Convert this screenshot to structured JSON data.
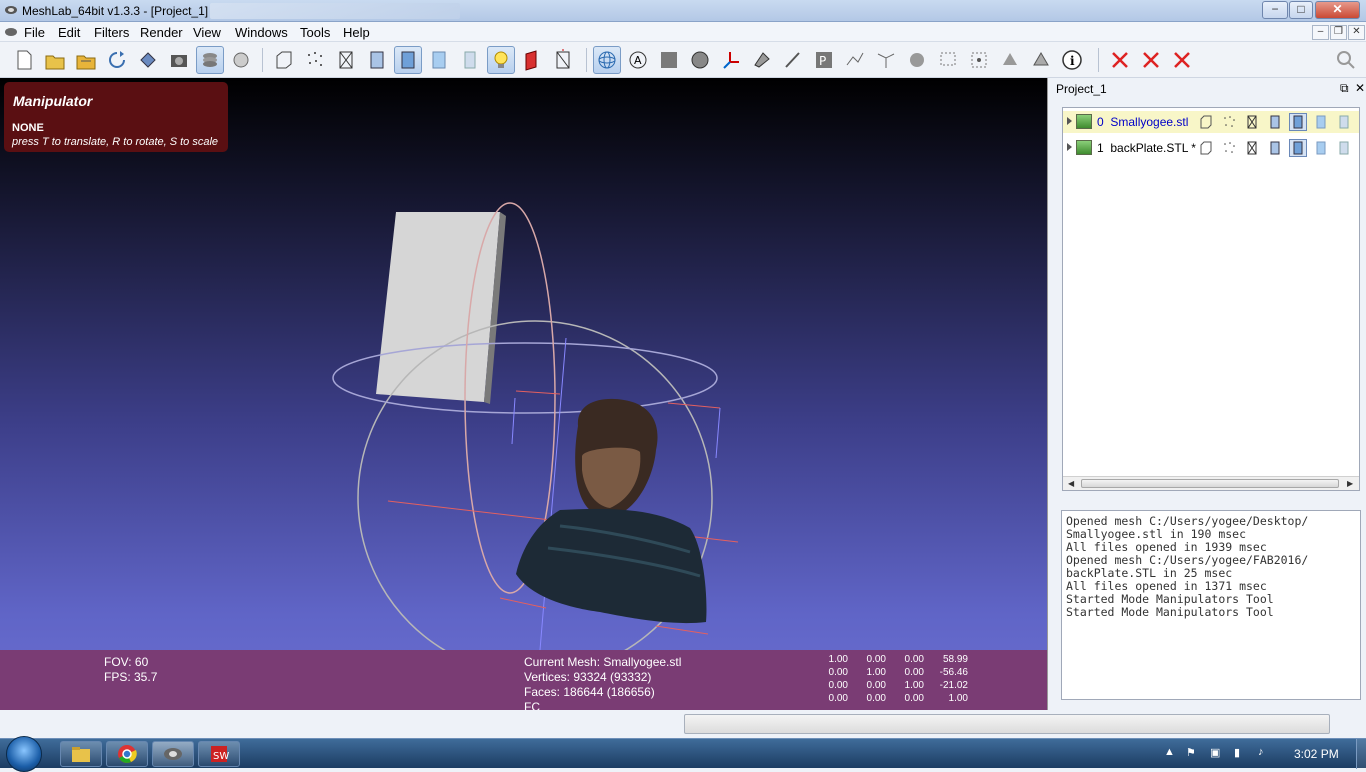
{
  "window": {
    "title": "MeshLab_64bit v1.3.3 - [Project_1]",
    "minimize": "−",
    "maximize": "□",
    "close": "✕"
  },
  "menu": {
    "items": [
      "File",
      "Edit",
      "Filters",
      "Render",
      "View",
      "Windows",
      "Tools",
      "Help"
    ]
  },
  "toolbar": {
    "icons": [
      "new-icon",
      "open-icon",
      "open-project-icon",
      "reload-icon",
      "save-icon",
      "snapshot-icon",
      "layers-icon",
      "render-mode-icon",
      "bbox-icon",
      "points-icon",
      "wireframe-icon",
      "hidden-lines-icon",
      "flat-icon",
      "smooth-icon",
      "texture-icon",
      "light-icon",
      "backface-icon",
      "normals-icon",
      "manipulator-icon",
      "annotation-icon",
      "shade-icon",
      "select-faces-icon",
      "axis-icon",
      "paint-icon",
      "brush-icon",
      "parametrization-icon",
      "align-icon",
      "edit-vertex-icon",
      "measure-icon",
      "reference-icon",
      "pick-points-icon",
      "fit-icon",
      "edit-tool-icon",
      "info-icon",
      "remove-icon-1",
      "remove-icon-2",
      "remove-icon-3",
      "search-icon"
    ]
  },
  "viewport": {
    "manipulator_title": "Manipulator",
    "manipulator_mode": "NONE",
    "manipulator_hint": "press T to translate, R to rotate, S to scale",
    "fov": "FOV: 60",
    "fps": "FPS:    35.7",
    "current_mesh": "Current Mesh: Smallyogee.stl",
    "vertices": "Vertices: 93324 (93332)",
    "faces": "Faces: 186644 (186656)",
    "fc": "FC",
    "matrix": [
      [
        "1.00",
        "0.00",
        "0.00",
        "58.99"
      ],
      [
        "0.00",
        "1.00",
        "0.00",
        "-56.46"
      ],
      [
        "0.00",
        "0.00",
        "1.00",
        "-21.02"
      ],
      [
        "0.00",
        "0.00",
        "0.00",
        "1.00"
      ]
    ]
  },
  "panel": {
    "title": "Project_1",
    "float": "⧉",
    "close": "✕",
    "layers": [
      {
        "index": "0",
        "name": "Smallyogee.stl",
        "selected": true
      },
      {
        "index": "1",
        "name": "backPlate.STL *",
        "selected": false
      }
    ],
    "log": "Opened mesh C:/Users/yogee/Desktop/\nSmallyogee.stl in 190 msec\nAll files opened in 1939 msec\nOpened mesh C:/Users/yogee/FAB2016/\nbackPlate.STL in 25 msec\nAll files opened in 1371 msec\nStarted Mode Manipulators Tool\nStarted Mode Manipulators Tool"
  },
  "taskbar": {
    "clock": "3:02 PM",
    "apps": [
      "explorer-icon",
      "chrome-icon",
      "meshlab-icon",
      "solidworks-icon"
    ]
  },
  "colors": {
    "manipulator_box": "#5a0f12",
    "info_bar": "#7a3c74",
    "viewport_bottom": "#6b6fd0",
    "selected_layer": "#f8f6c8"
  }
}
